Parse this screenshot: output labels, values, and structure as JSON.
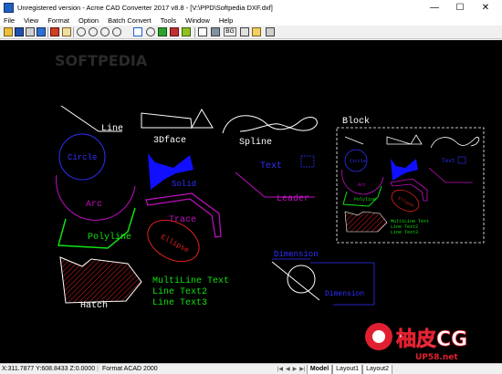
{
  "window": {
    "title": "Unregistered version - Acme CAD Converter 2017 v8.8 - [V:\\PPD\\Softpedia DXF.dxf]",
    "minimize_glyph": "—",
    "maximize_glyph": "☐",
    "close_glyph": "✕"
  },
  "menu": [
    "File",
    "View",
    "Format",
    "Option",
    "Batch Convert",
    "Tools",
    "Window",
    "Help"
  ],
  "toolbar": {
    "bg_label": "BG",
    "icons": [
      "open-icon",
      "save-icon",
      "print-icon",
      "export-icon",
      "convert-icon",
      "pan-icon",
      "zoom-in-icon",
      "zoom-out-icon",
      "zoom-window-icon",
      "zoom-realtime-icon",
      "zoom-extents-icon",
      "zoom-previous-icon",
      "layer-icon",
      "measure-icon",
      "color-icon",
      "bw-icon",
      "background-icon",
      "text-icon",
      "settings-icon"
    ]
  },
  "drawing": {
    "labels": {
      "line": "Line",
      "face3d": "3Dface",
      "spline": "Spline",
      "block": "Block",
      "circle": "Circle",
      "solid": "Solid",
      "text": "Text",
      "arc": "Arc",
      "leader": "Leader",
      "trace": "Trace",
      "polyline": "Polyline",
      "ellipse": "Ellipse",
      "multiline": [
        "MultiLine Text",
        "Line Text2",
        "Line Text3"
      ],
      "hatch": "Hatch",
      "dimension": "Dimension"
    },
    "block_labels": {
      "circle": "Circle",
      "text": "Text",
      "arc": "Arc",
      "polyline": "Polyline",
      "ellipse": "Ellipse",
      "multiline": [
        "MultiLine Text",
        "Line Text2",
        "Line Text3"
      ]
    }
  },
  "watermarks": {
    "softpedia": "SOFTPEDIA",
    "site_logo": "柚皮CG",
    "site_url": "UP58.net"
  },
  "status": {
    "coords": "X:311.7877 Y:608.8433 Z:0.0000",
    "format": "Format ACAD 2000",
    "nav": [
      "|◀",
      "◀",
      "▶",
      "▶|"
    ],
    "tabs": [
      "Model",
      "Layout1",
      "Layout2"
    ]
  },
  "colors": {
    "canvas_bg": "#000000",
    "white": "#ffffff",
    "blue": "#1010ff",
    "magenta": "#c010c0",
    "green": "#10e010",
    "red": "#e02020"
  }
}
